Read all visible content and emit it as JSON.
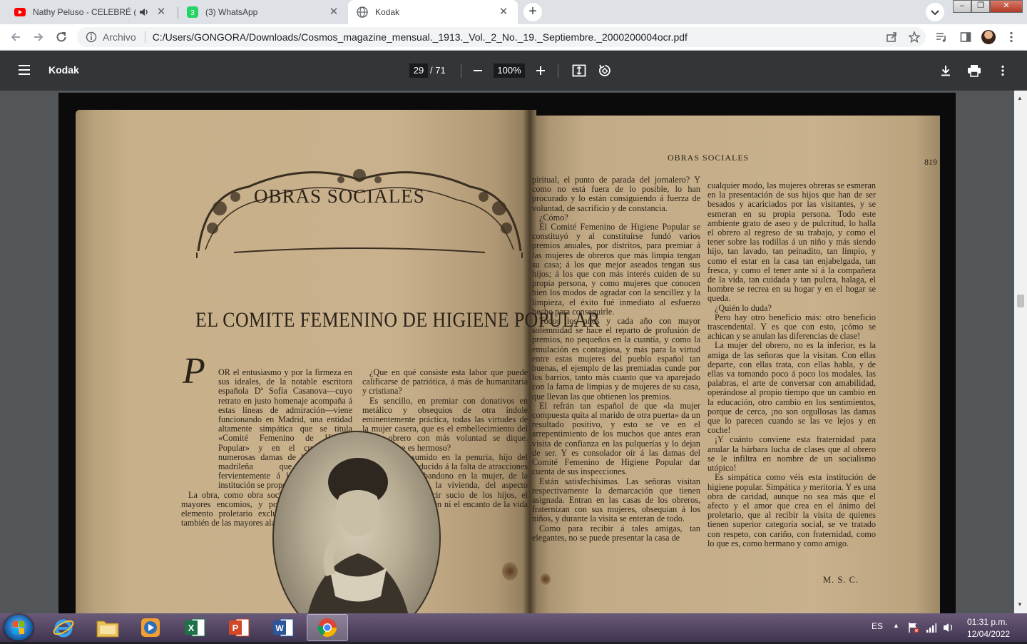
{
  "browser": {
    "tabs": [
      {
        "title": "Nathy Peluso - CELEBRÉ (Lyri",
        "icon": "youtube-icon",
        "audio": true
      },
      {
        "title": "(3) WhatsApp",
        "icon": "whatsapp-icon"
      },
      {
        "title": "Kodak",
        "icon": "globe-icon"
      }
    ],
    "site_chip": "Archivo",
    "url": "C:/Users/GONGORA/Downloads/Cosmos_magazine_mensual._1913._Vol._2_No._19._Septiembre._2000200004ocr.pdf"
  },
  "pdf": {
    "title": "Kodak",
    "page_current": "29",
    "page_total": "/ 71",
    "zoom": "100%"
  },
  "scan": {
    "section_title": "OBRAS SOCIALES",
    "article_title": "EL COMITE FEMENINO DE HIGIENE POPULAR",
    "dropcap": "P",
    "running_head": "OBRAS SOCIALES",
    "page_number": "819",
    "col1": "OR el entusiasmo y por la firmeza en sus ideales, de la notable escritora española Dª Sofía Casanova—cuyo retrato en justo homenaje acompaña á estas líneas de admiración—viene funcionando en Madrid, una entidad altamente simpática que se titula «Comité Femenino de Higiene Popular» y en el cual figuran numerosas damas de la aristocracia madrileña que colaboran fervientemente á los fines que tal institución se propone.",
    "col1b": "La obra, como obra social, es digna de los mayores encomios, y por estar dedicada al elemento proletario exclusivamente, es digna también de las mayores alabanzas.",
    "col2": "¿Que en qué consiste esta labor que puede calificarse de patriótica, á más de humanitaria y cristiana?",
    "col2b": "Es sencillo, en premiar con donativos en metálico y obsequios de otra índole eminentemente práctica, todas las virtudes de la mujer casera, que es el embellecimiento del hogar obrero con más voluntad se dique. ¿Verdad que es hermoso?",
    "col2c": "El obrero, sumido en la penuria, hijo del escaso jornal, reducido á la falta de atracciones que nacen del abandono en la mujer, de la escasa higiene en la vivienda, del aspecto descuidado que decir sucio de los hijos, el obrero, en fin, á quien ni el encanto de la vida de familia parece que",
    "col3": "piritual, el punto de parada del jornalero? Y como no está fuera de lo posible, lo han procurado y lo están consiguiendo á fuerza de voluntad, de sacrificio y de constancia.",
    "col3b": "¿Cómo?",
    "col3c": "El Comité Femenino de Higiene Popular se constituyó y al constituírse fundó varios premios anuales, por distritos, para premiar á las mujeres de obreros que más limpia tengan su casa; á los que mejor aseados tengan sus hijos; á los que con más interés cuiden de su propia persona, y como mujeres que conocen bien los modos de agradar con la sencillez y la limpieza, el éxito fué inmediato al esfuerzo hecho para conseguirle.",
    "col3d": "Todos los años y cada año con mayor solemnidad se hace el reparto de profusión de premios, no pequeños en la cuantía, y como la emulación es contagiosa, y más para la virtud entre estas mujeres del pueblo español tan buenas, el ejemplo de las premiadas cunde por los barrios, tanto más cuanto que va aparejado con la fama de limpias y de mujeres de su casa, que llevan las que obtienen los premios.",
    "col3e": "El refrán tan español de que «la mujer compuesta quita al marido de otra puerta» da un resultado positivo, y esto se ve en el arrepentimiento de los muchos que antes eran visita de confianza en las pulquerías y lo dejan de ser. Y es consolador oír á las damas del Comité Femenino de Higiene Popular dar cuenta de sus inspecciones.",
    "col3f": "Están satisfechísimas. Las señoras visitan respectivamente la demarcación que tienen asignada. Entran en las casas de los obreros, fraternizan con sus mujeres, obsequian á los niños, y durante la visita se enteran de todo.",
    "col3g": "Como para recibir á tales amigas, tan elegantes, no se puede presentar la casa de",
    "col4": "cualquier modo, las mujeres obreras se esmeran en la presentación de sus hijos que han de ser besados y acariciados por las visitantes, y se esmeran en su propia persona. Todo este ambiente grato de aseo y de pulcritud, lo halla el obrero al regreso de su trabajo, y como el tener sobre las rodillas á un niño y más siendo hijo, tan lavado, tan peinadito, tan limpio, y como el estar en la casa tan enjabelgada, tan fresca, y como el tener ante sí á la compañera de la vida, tan cuidada y tan pulcra, halaga, el hombre se recrea en su hogar y en el hogar se queda.",
    "col4b": "¿Quién lo duda?",
    "col4c": "Pero hay otro beneficio más: otro beneficio trascendental. Y es que con esto, ¡cómo se achican y se anulan las diferencias de clase!",
    "col4d": "La mujer del obrero, no es la inferior, es la amiga de las señoras que la visitan. Con ellas departe, con ellas trata, con ellas habla, y de ellas va tomando poco á poco los modales, las palabras, el arte de conversar con amabilidad, operándose al propio tiempo que un cambio en la educación, otro cambio en los sentimientos, porque de cerca, ¡no son orgullosas las damas que lo parecen cuando se las ve lejos y en coche!",
    "col4e": "¡Y cuánto conviene esta fraternidad para anular la bárbara lucha de clases que al obrero se le infiltra en nombre de un socialismo utópico!",
    "col4f": "Es simpática como véis esta institución de higiene popular. Simpática y meritoria. Y es una obra de caridad, aunque no sea más que el afecto y el amor que crea en el ánimo del proletario, que al recibir la visita de quienes tienen superior categoría social, se ve tratado con respeto, con cariño, con fraternidad, como lo que es, como hermano y como amigo.",
    "signature": "M. S. C."
  },
  "taskbar": {
    "apps": [
      "windows-start",
      "internet-explorer",
      "file-explorer",
      "media-player",
      "excel",
      "powerpoint",
      "word",
      "chrome"
    ],
    "lang": "ES",
    "time": "01:31 p.m.",
    "date": "12/04/2022"
  }
}
